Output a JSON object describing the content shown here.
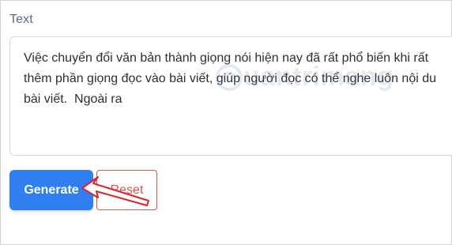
{
  "form": {
    "text_label": "Text",
    "text_value": "Việc chuyển đổi văn bản thành giọng nói hiện nay đã rất phổ biến khi rất\nthêm phần giọng đọc vào bài viết, giúp người đọc có thể nghe luôn nội du\nbài viết.  Ngoài ra"
  },
  "buttons": {
    "generate_label": "Generate",
    "reset_label": "Reset"
  },
  "watermark": {
    "text": "uantrimang"
  },
  "colors": {
    "primary": "#2f7ff0",
    "danger": "#d9534f",
    "annotation_arrow": "#e0202a"
  }
}
